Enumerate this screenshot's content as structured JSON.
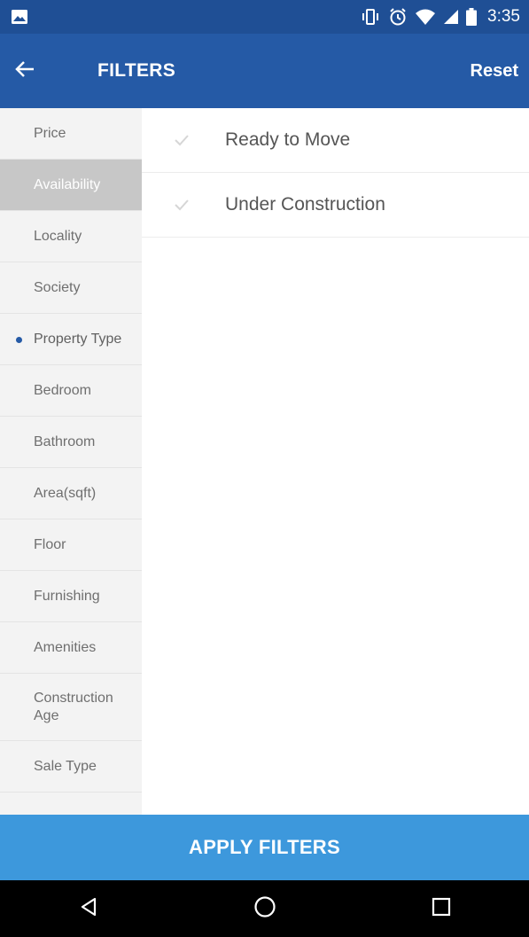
{
  "status_bar": {
    "time": "3:35",
    "icons": [
      "image-icon",
      "vibrate-icon",
      "alarm-icon",
      "wifi-icon",
      "signal-icon",
      "battery-icon"
    ]
  },
  "app_bar": {
    "title": "FILTERS",
    "reset_label": "Reset",
    "back_icon": "arrow-left-icon"
  },
  "sidebar": {
    "items": [
      {
        "label": "Price"
      },
      {
        "label": "Availability"
      },
      {
        "label": "Locality"
      },
      {
        "label": "Society"
      },
      {
        "label": "Property Type"
      },
      {
        "label": "Bedroom"
      },
      {
        "label": "Bathroom"
      },
      {
        "label": "Area(sqft)"
      },
      {
        "label": "Floor"
      },
      {
        "label": "Furnishing"
      },
      {
        "label": "Amenities"
      },
      {
        "label": "Construction Age"
      },
      {
        "label": "Sale Type"
      }
    ],
    "active": "Availability",
    "marked": "Property Type"
  },
  "options": [
    {
      "label": "Ready to Move",
      "checked": false
    },
    {
      "label": "Under Construction",
      "checked": false
    }
  ],
  "apply_label": "APPLY FILTERS",
  "colors": {
    "status_bar": "#1f4f95",
    "app_bar": "#255aa6",
    "apply_button": "#3d98dc",
    "active_item": "#c7c7c7"
  }
}
